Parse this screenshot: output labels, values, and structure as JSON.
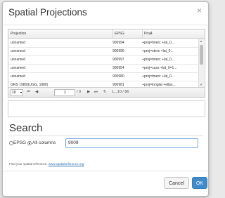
{
  "dialog": {
    "title": "Spatial Projections",
    "close_glyph": "×"
  },
  "grid": {
    "columns": [
      "Projection",
      "EPSG",
      "Proj4"
    ],
    "rows": [
      {
        "projection": "unnamed",
        "epsg": "900994",
        "proj4": "+proj=tmerc +lat_0..."
      },
      {
        "projection": "unnamed",
        "epsg": "900996",
        "proj4": "+proj=stere +lat_0..."
      },
      {
        "projection": "unnamed",
        "epsg": "900997",
        "proj4": "+proj=tmerc +lat_0..."
      },
      {
        "projection": "unnamed",
        "epsg": "900954",
        "proj4": "+proj=cass +lat_0=1..."
      },
      {
        "projection": "unnamed",
        "epsg": "900980",
        "proj4": "+proj=tmerc +lat_0..."
      },
      {
        "projection": "GRS 1980(IUGG, 1980)",
        "epsg": "900981",
        "proj4": "+proj=longlat +ellps..."
      }
    ]
  },
  "pager": {
    "page_size": "10",
    "page_size_caret": "▾",
    "first": "⏮",
    "prev": "◀",
    "current_page": "1",
    "page_total": "/ 9",
    "next": "▶",
    "last": "⏭",
    "refresh": "↻",
    "range_text": "1...10 / 86"
  },
  "search": {
    "heading": "Search",
    "radio_epsg": "EPSG",
    "radio_all": "All columns",
    "selected": "all_columns",
    "query": "9009"
  },
  "footer": {
    "note_prefix": "Find your spatial reference: ",
    "link_text": "www.spatialreference.org",
    "cancel_label": "Cancel",
    "ok_label": "OK"
  },
  "colors": {
    "primary": "#428bca",
    "link": "#2a6db0"
  }
}
